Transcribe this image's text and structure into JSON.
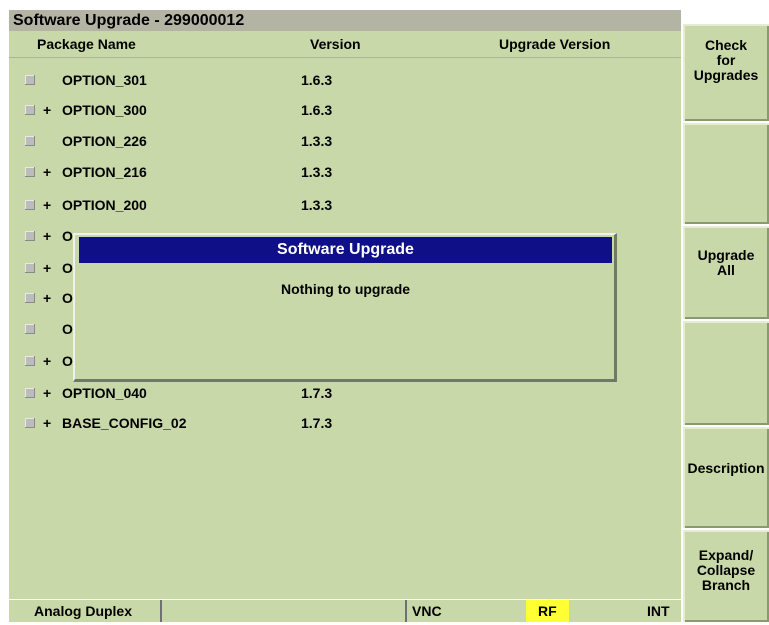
{
  "window": {
    "title": "Software Upgrade - 299000012"
  },
  "columns": {
    "name": "Package Name",
    "version": "Version",
    "upgrade": "Upgrade Version"
  },
  "packages": [
    {
      "expander": "",
      "name": "OPTION_301",
      "version": "1.6.3"
    },
    {
      "expander": "+",
      "name": "OPTION_300",
      "version": "1.6.3"
    },
    {
      "expander": "",
      "name": "OPTION_226",
      "version": "1.3.3"
    },
    {
      "expander": "+",
      "name": "OPTION_216",
      "version": "1.3.3"
    },
    {
      "expander": "+",
      "name": "OPTION_200",
      "version": "1.3.3"
    },
    {
      "expander": "+",
      "name": "O",
      "version": ""
    },
    {
      "expander": "+",
      "name": "O",
      "version": ""
    },
    {
      "expander": "+",
      "name": "O",
      "version": ""
    },
    {
      "expander": "",
      "name": "O",
      "version": ""
    },
    {
      "expander": "+",
      "name": "O",
      "version": ""
    },
    {
      "expander": "+",
      "name": "OPTION_040",
      "version": "1.7.3"
    },
    {
      "expander": "+",
      "name": "BASE_CONFIG_02",
      "version": "1.7.3"
    }
  ],
  "dialog": {
    "title": "Software Upgrade",
    "message": "Nothing to upgrade"
  },
  "softkeys": [
    {
      "label": "Check\nfor\nUpgrades"
    },
    {
      "label": ""
    },
    {
      "label": "Upgrade\nAll"
    },
    {
      "label": ""
    },
    {
      "label": "Description"
    },
    {
      "label": "Expand/\nCollapse\nBranch"
    }
  ],
  "status": {
    "mode": "Analog Duplex",
    "blank": "",
    "vnc": "VNC",
    "rf": "RF",
    "int": "INT"
  },
  "colors": {
    "panel": "#c8d8a8",
    "titlebar": "#b4b4a4",
    "dialog_title": "#0f0f87",
    "rf_highlight": "#ffff33"
  }
}
